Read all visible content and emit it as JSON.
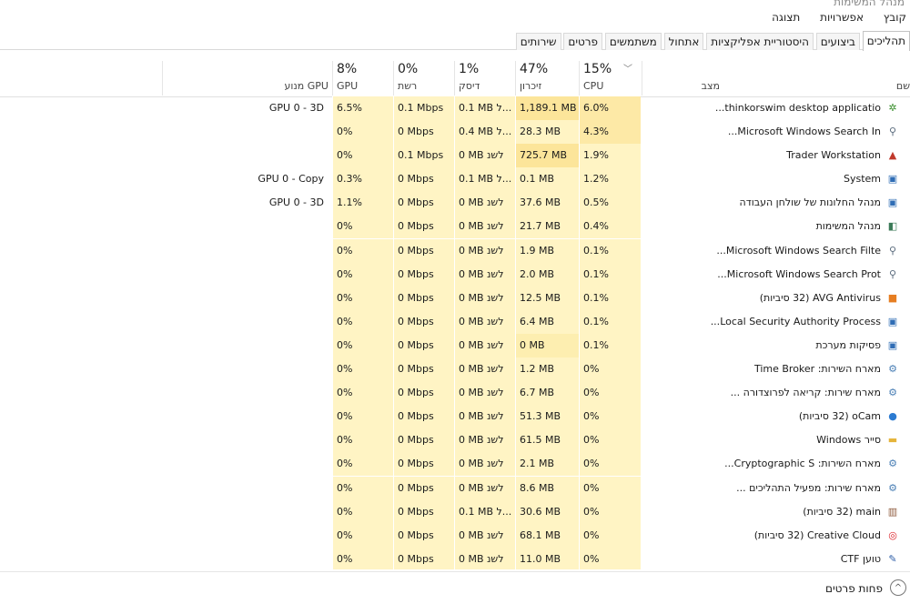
{
  "window": {
    "title": "מנהל המשימות"
  },
  "menu": [
    "קובץ",
    "אפשרויות",
    "תצוגה"
  ],
  "tabs": [
    {
      "label": "תהליכים",
      "active": true
    },
    {
      "label": "ביצועים",
      "active": false
    },
    {
      "label": "היסטוריית אפליקציות",
      "active": false
    },
    {
      "label": "אתחול",
      "active": false
    },
    {
      "label": "משתמשים",
      "active": false
    },
    {
      "label": "פרטים",
      "active": false
    },
    {
      "label": "שירותים",
      "active": false
    }
  ],
  "columns": {
    "name": "שם",
    "status": "מצב",
    "cpu": {
      "pct": "15%",
      "label": "CPU"
    },
    "memory": {
      "pct": "47%",
      "label": "זיכרון"
    },
    "disk": {
      "pct": "1%",
      "label": "דיסק"
    },
    "network": {
      "pct": "0%",
      "label": "רשת"
    },
    "gpu": {
      "pct": "8%",
      "label": "GPU"
    },
    "gpu_engine": "מנוע GPU"
  },
  "processes": [
    {
      "name": "thinkorswim desktop applicatio...",
      "icon": "thinkorswim-icon",
      "icon_glyph": "✲",
      "icon_color": "#3a8f2d",
      "cpu": "6.0%",
      "memory": "1,189.1 MB",
      "disk": "0.1 MB ל...",
      "network": "0.1 Mbps",
      "gpu": "6.5%",
      "gpu_engine": "GPU 0 - 3D",
      "mem_level": 1,
      "cpu_level": 1
    },
    {
      "name": "Microsoft Windows Search In...",
      "icon": "search-indexer-icon",
      "icon_glyph": "⚲",
      "icon_color": "#5a6b7d",
      "cpu": "4.3%",
      "memory": "28.3 MB",
      "disk": "0.4 MB ל...",
      "network": "0 Mbps",
      "gpu": "0%",
      "gpu_engine": "",
      "mem_level": 0,
      "cpu_level": 1
    },
    {
      "name": "Trader Workstation",
      "icon": "trader-workstation-icon",
      "icon_glyph": "▲",
      "icon_color": "#c0392b",
      "cpu": "1.9%",
      "memory": "725.7 MB",
      "disk": "0 MB לשנ",
      "network": "0.1 Mbps",
      "gpu": "0%",
      "gpu_engine": "",
      "mem_level": 1,
      "cpu_level": 0
    },
    {
      "name": "System",
      "icon": "system-icon",
      "icon_glyph": "▣",
      "icon_color": "#2f6db5",
      "cpu": "1.2%",
      "memory": "0.1 MB",
      "disk": "0.1 MB ל...",
      "network": "0 Mbps",
      "gpu": "0.3%",
      "gpu_engine": "GPU 0 - Copy",
      "mem_level": 0,
      "cpu_level": 0
    },
    {
      "name": "מנהל החלונות של שולחן העבודה",
      "icon": "window-manager-icon",
      "icon_glyph": "▣",
      "icon_color": "#2f6db5",
      "cpu": "0.5%",
      "memory": "37.6 MB",
      "disk": "0 MB לשנ",
      "network": "0 Mbps",
      "gpu": "1.1%",
      "gpu_engine": "GPU 0 - 3D",
      "mem_level": 0,
      "cpu_level": 0
    },
    {
      "name": "מנהל המשימות",
      "icon": "task-manager-icon",
      "icon_glyph": "◧",
      "icon_color": "#3b7a57",
      "cpu": "0.4%",
      "memory": "21.7 MB",
      "disk": "0 MB לשנ",
      "network": "0 Mbps",
      "gpu": "0%",
      "gpu_engine": "",
      "mem_level": 0,
      "cpu_level": 0
    },
    {
      "name": "Microsoft Windows Search Filte...",
      "icon": "search-filter-icon",
      "icon_glyph": "⚲",
      "icon_color": "#5a6b7d",
      "cpu": "0.1%",
      "memory": "1.9 MB",
      "disk": "0 MB לשנ",
      "network": "0 Mbps",
      "gpu": "0%",
      "gpu_engine": "",
      "mem_level": 0,
      "cpu_level": 0
    },
    {
      "name": "Microsoft Windows Search Prot...",
      "icon": "search-protocol-icon",
      "icon_glyph": "⚲",
      "icon_color": "#5a6b7d",
      "cpu": "0.1%",
      "memory": "2.0 MB",
      "disk": "0 MB לשנ",
      "network": "0 Mbps",
      "gpu": "0%",
      "gpu_engine": "",
      "mem_level": 0,
      "cpu_level": 0
    },
    {
      "name": "AVG Antivirus (32 סיביות)",
      "icon": "avg-antivirus-icon",
      "icon_glyph": "■",
      "icon_color": "#e67e22",
      "cpu": "0.1%",
      "memory": "12.5 MB",
      "disk": "0 MB לשנ",
      "network": "0 Mbps",
      "gpu": "0%",
      "gpu_engine": "",
      "mem_level": 0,
      "cpu_level": 0
    },
    {
      "name": "Local Security Authority Process...",
      "icon": "lsa-process-icon",
      "icon_glyph": "▣",
      "icon_color": "#2f6db5",
      "cpu": "0.1%",
      "memory": "6.4 MB",
      "disk": "0 MB לשנ",
      "network": "0 Mbps",
      "gpu": "0%",
      "gpu_engine": "",
      "mem_level": 0,
      "cpu_level": 0
    },
    {
      "name": "פסיקות מערכת",
      "icon": "system-interrupts-icon",
      "icon_glyph": "▣",
      "icon_color": "#2f6db5",
      "cpu": "0.1%",
      "memory": "0 MB",
      "disk": "0 MB לשנ",
      "network": "0 Mbps",
      "gpu": "0%",
      "gpu_engine": "",
      "mem_level": 0,
      "cpu_level": 0
    },
    {
      "name": "מארח השירות: Time Broker",
      "icon": "service-host-gear-icon",
      "icon_glyph": "⚙",
      "icon_color": "#4a7fb5",
      "cpu": "0%",
      "memory": "1.2 MB",
      "disk": "0 MB לשנ",
      "network": "0 Mbps",
      "gpu": "0%",
      "gpu_engine": "",
      "mem_level": 0,
      "cpu_level": 0
    },
    {
      "name": "מארח שירות: קריאה לפרוצדורה ...",
      "icon": "service-host-gear-icon",
      "icon_glyph": "⚙",
      "icon_color": "#4a7fb5",
      "cpu": "0%",
      "memory": "6.7 MB",
      "disk": "0 MB לשנ",
      "network": "0 Mbps",
      "gpu": "0%",
      "gpu_engine": "",
      "mem_level": 0,
      "cpu_level": 0
    },
    {
      "name": "oCam (32 סיביות)",
      "icon": "ocam-icon",
      "icon_glyph": "●",
      "icon_color": "#2c7bd1",
      "cpu": "0%",
      "memory": "51.3 MB",
      "disk": "0 MB לשנ",
      "network": "0 Mbps",
      "gpu": "0%",
      "gpu_engine": "",
      "mem_level": 0,
      "cpu_level": 0
    },
    {
      "name": "סייר Windows",
      "icon": "file-explorer-icon",
      "icon_glyph": "▬",
      "icon_color": "#e5b43b",
      "cpu": "0%",
      "memory": "61.5 MB",
      "disk": "0 MB לשנ",
      "network": "0 Mbps",
      "gpu": "0%",
      "gpu_engine": "",
      "mem_level": 0,
      "cpu_level": 0
    },
    {
      "name": "מארח השירות: Cryptographic S...",
      "icon": "service-host-gear-icon",
      "icon_glyph": "⚙",
      "icon_color": "#4a7fb5",
      "cpu": "0%",
      "memory": "2.1 MB",
      "disk": "0 MB לשנ",
      "network": "0 Mbps",
      "gpu": "0%",
      "gpu_engine": "",
      "mem_level": 0,
      "cpu_level": 0
    },
    {
      "name": "מארח שירות: מפעיל התהליכים ...",
      "icon": "service-host-gear-icon",
      "icon_glyph": "⚙",
      "icon_color": "#4a7fb5",
      "cpu": "0%",
      "memory": "8.6 MB",
      "disk": "0 MB לשנ",
      "network": "0 Mbps",
      "gpu": "0%",
      "gpu_engine": "",
      "mem_level": 0,
      "cpu_level": 0
    },
    {
      "name": "main (32 סיביות)",
      "icon": "main-app-icon",
      "icon_glyph": "▥",
      "icon_color": "#8e5a3c",
      "cpu": "0%",
      "memory": "30.6 MB",
      "disk": "0.1 MB ל...",
      "network": "0 Mbps",
      "gpu": "0%",
      "gpu_engine": "",
      "mem_level": 0,
      "cpu_level": 0
    },
    {
      "name": "Creative Cloud (32 סיביות)",
      "icon": "creative-cloud-icon",
      "icon_glyph": "◎",
      "icon_color": "#da1f26",
      "cpu": "0%",
      "memory": "68.1 MB",
      "disk": "0 MB לשנ",
      "network": "0 Mbps",
      "gpu": "0%",
      "gpu_engine": "",
      "mem_level": 0,
      "cpu_level": 0
    },
    {
      "name": "טוען CTF",
      "icon": "ctf-loader-icon",
      "icon_glyph": "✎",
      "icon_color": "#2f5fa8",
      "cpu": "0%",
      "memory": "11.0 MB",
      "disk": "0 MB לשנ",
      "network": "0 Mbps",
      "gpu": "0%",
      "gpu_engine": "",
      "mem_level": 0,
      "cpu_level": 0
    }
  ],
  "footer": {
    "fewer_details": "פחות פרטים",
    "toggle_glyph": "^"
  }
}
